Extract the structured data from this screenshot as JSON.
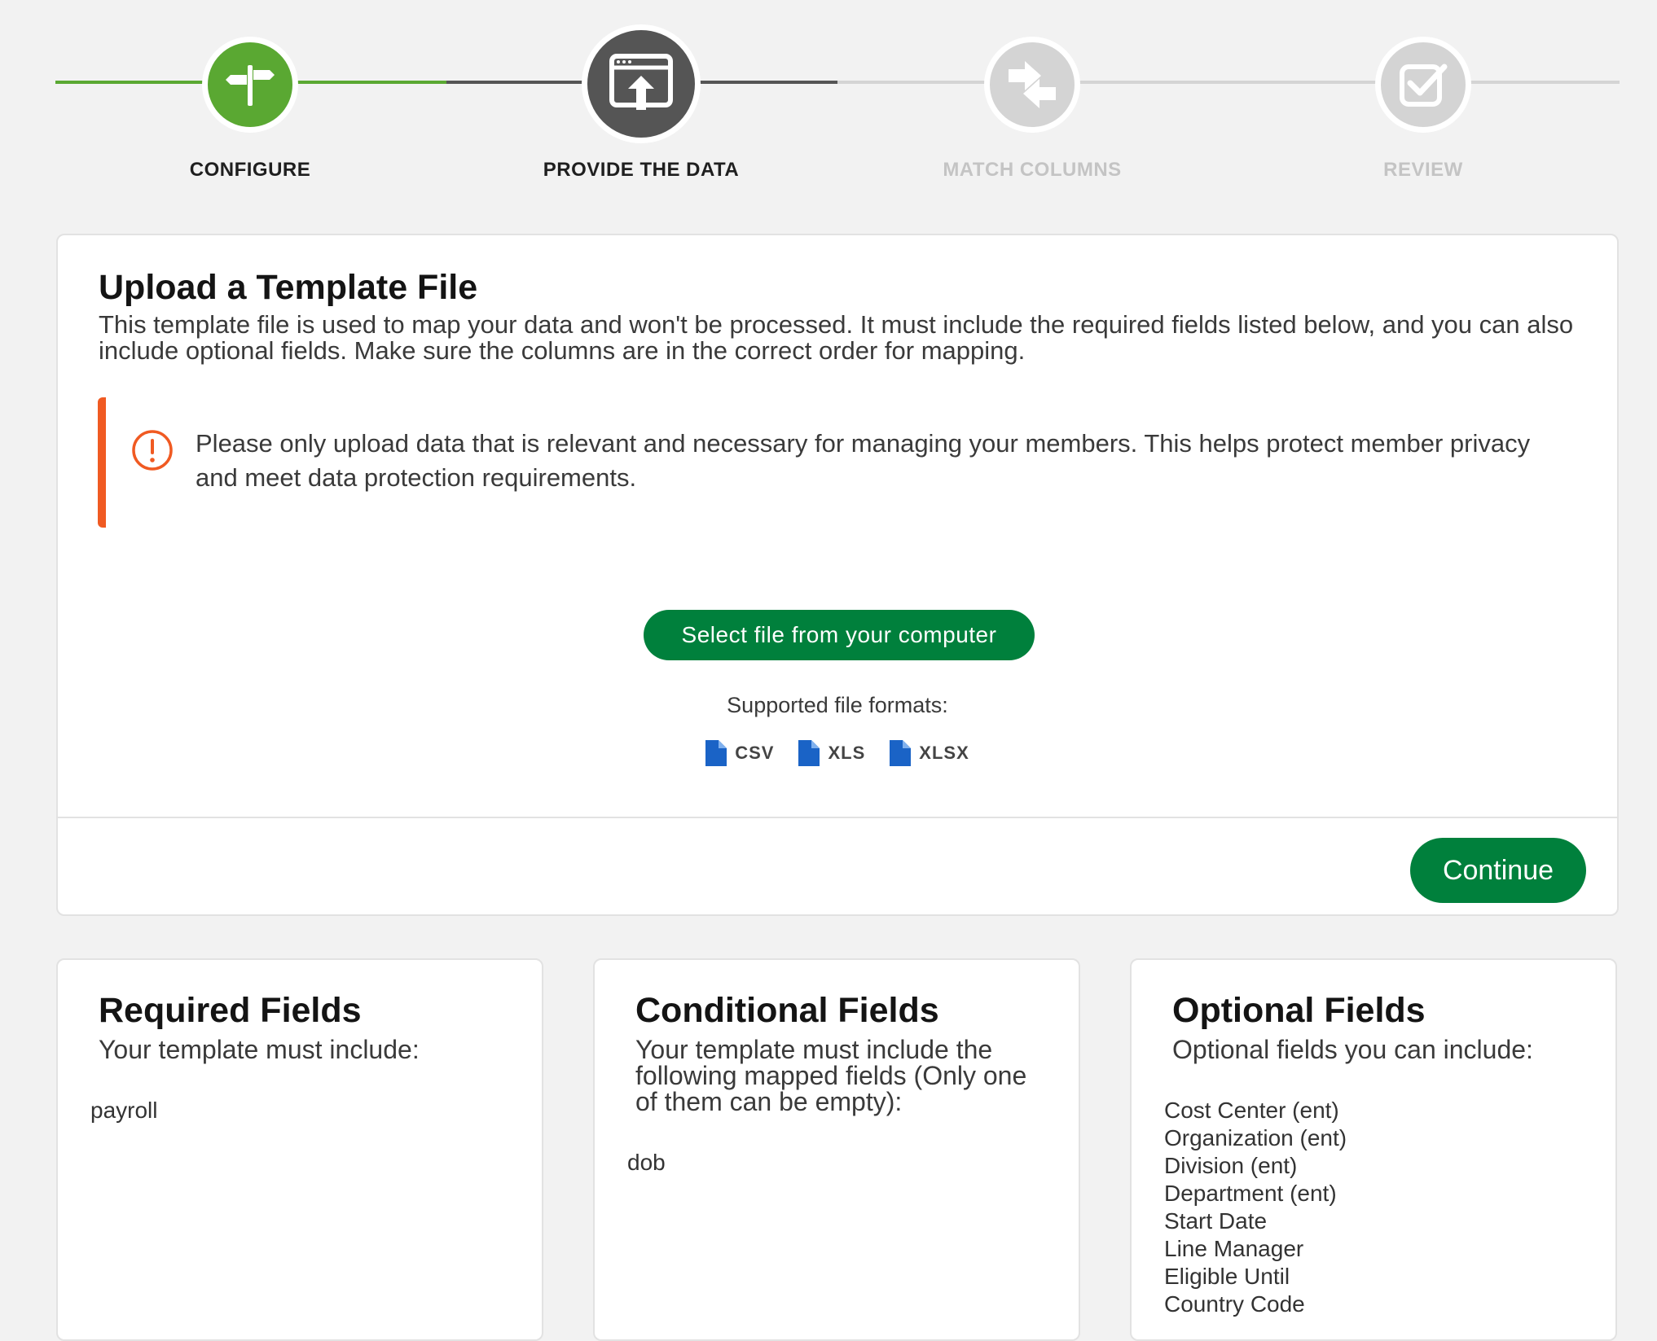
{
  "stepper": {
    "steps": [
      {
        "label": "CONFIGURE",
        "state": "done",
        "icon": "signpost-icon"
      },
      {
        "label": "PROVIDE THE DATA",
        "state": "active",
        "icon": "upload-screen-icon"
      },
      {
        "label": "MATCH COLUMNS",
        "state": "pending",
        "icon": "swap-arrows-icon"
      },
      {
        "label": "REVIEW",
        "state": "pending",
        "icon": "checkbox-icon"
      }
    ]
  },
  "colors": {
    "brand_green": "#00803c",
    "step_done_green": "#5aa832",
    "step_active_gray": "#555555",
    "step_pending_gray": "#d4d4d4",
    "warning_orange": "#f05a22",
    "file_icon_blue": "#1a63c6"
  },
  "upload": {
    "title": "Upload a Template File",
    "description": "This template file is used to map your data and won't be processed. It must include the required fields listed below, and you can also include optional fields. Make sure the columns are in the correct order for mapping.",
    "notice": "Please only upload data that is relevant and necessary for managing your members. This helps protect member privacy and meet data protection requirements.",
    "select_button": "Select file from your computer",
    "formats_label": "Supported file formats:",
    "formats": [
      "CSV",
      "XLS",
      "XLSX"
    ],
    "continue_button": "Continue"
  },
  "required": {
    "title": "Required Fields",
    "subtitle": "Your template must include:",
    "fields": [
      "payroll"
    ]
  },
  "conditional": {
    "title": "Conditional Fields",
    "subtitle": "Your template must include the following mapped fields (Only one of them can be empty):",
    "fields": [
      "dob"
    ]
  },
  "optional": {
    "title": "Optional Fields",
    "subtitle": "Optional fields you can include:",
    "fields": [
      "Cost Center (ent)",
      "Organization (ent)",
      "Division (ent)",
      "Department (ent)",
      "Start Date",
      "Line Manager",
      "Eligible Until",
      "Country Code"
    ]
  }
}
